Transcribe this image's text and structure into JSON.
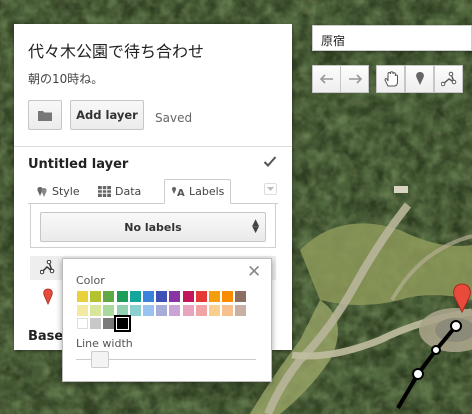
{
  "map": {
    "title": "代々木公園で待ち合わせ",
    "description": "朝の10時ね。",
    "add_layer_label": "Add layer",
    "saved_label": "Saved",
    "search_value": "原宿"
  },
  "layer": {
    "title": "Untitled layer",
    "tabs": [
      {
        "label": "Style",
        "icon": "style-icon"
      },
      {
        "label": "Data",
        "icon": "table-icon"
      },
      {
        "label": "Labels",
        "icon": "labels-icon"
      }
    ],
    "active_tab": "Labels",
    "labels_select": "No labels",
    "checked": true
  },
  "base_map": {
    "label": "Base"
  },
  "popup": {
    "color_label": "Color",
    "line_width_label": "Line width",
    "line_width_value": 0.1,
    "selected_color": "#000000",
    "colors": [
      [
        "#e8d13a",
        "#b5c22f",
        "#60a844",
        "#1d9d59",
        "#15a59b",
        "#3b82db",
        "#3f51b5",
        "#8a35a5",
        "#c2185b",
        "#e53935",
        "#f59e0b",
        "#fb8c00",
        "#8d6e63"
      ],
      [
        "#f4e9a0",
        "#d8e69a",
        "#a8d89a",
        "#8fd0b0",
        "#8ad0d0",
        "#99c2ee",
        "#a8acd8",
        "#c8a5d6",
        "#e8a4bf",
        "#f2a3a3",
        "#f8cf8e",
        "#f7be8e",
        "#c8b0a4"
      ],
      [
        "#ffffff",
        "#c8c8c8",
        "#7a7a7a",
        "#000000"
      ]
    ]
  },
  "toolbar": {
    "buttons": [
      "undo-icon",
      "redo-icon",
      "hand-icon",
      "marker-icon",
      "line-icon"
    ]
  }
}
